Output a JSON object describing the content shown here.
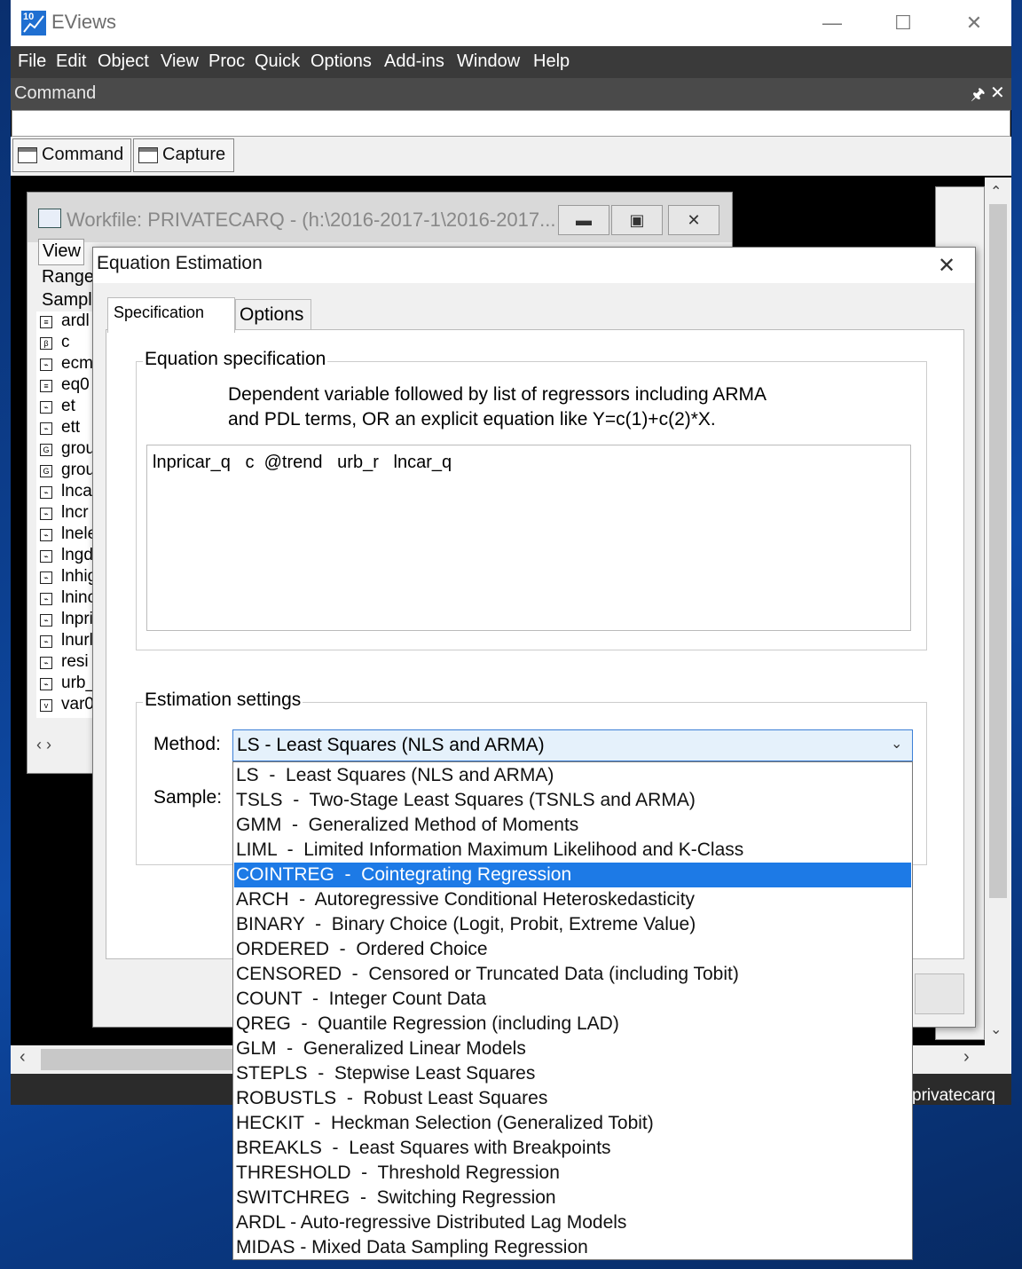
{
  "app": {
    "title": "EViews",
    "logo_text": "10",
    "minimize": "—",
    "maximize": "☐",
    "close": "✕"
  },
  "menu": [
    "File",
    "Edit",
    "Object",
    "View",
    "Proc",
    "Quick",
    "Options",
    "Add-ins",
    "Window",
    "Help"
  ],
  "command_pane": {
    "title": "Command",
    "pin": "🖈",
    "close": "✕",
    "tabs": [
      "Command",
      "Capture"
    ]
  },
  "workfile": {
    "title": "Workfile: PRIVATECARQ - (h:\\2016-2017-1\\2016-2017...",
    "view_btn": "View",
    "range_label": "Range",
    "sample_label": "Sampl",
    "objects": [
      {
        "icon": "eq",
        "name": "ardl"
      },
      {
        "icon": "β",
        "name": "c"
      },
      {
        "icon": "series",
        "name": "ecm"
      },
      {
        "icon": "eq",
        "name": "eq0"
      },
      {
        "icon": "series",
        "name": "et"
      },
      {
        "icon": "series",
        "name": "ett"
      },
      {
        "icon": "G",
        "name": "grou"
      },
      {
        "icon": "G",
        "name": "grou"
      },
      {
        "icon": "series",
        "name": "lnca"
      },
      {
        "icon": "series",
        "name": "lncr"
      },
      {
        "icon": "series",
        "name": "lnele"
      },
      {
        "icon": "series",
        "name": "lngd"
      },
      {
        "icon": "series",
        "name": "lnhig"
      },
      {
        "icon": "series",
        "name": "lninc"
      },
      {
        "icon": "series",
        "name": "lnpri"
      },
      {
        "icon": "series",
        "name": "lnurl"
      },
      {
        "icon": "series",
        "name": "resi"
      },
      {
        "icon": "series",
        "name": "urb_"
      },
      {
        "icon": "var",
        "name": "var0"
      }
    ],
    "scroll_glyphs": "‹ ›"
  },
  "status": {
    "workfile_name": "privatecarq"
  },
  "dialog": {
    "title": "Equation Estimation",
    "close": "✕",
    "tabs": {
      "specification": "Specification",
      "options": "Options"
    },
    "eq_spec_legend": "Equation specification",
    "help_line1": "Dependent variable followed by list of regressors including ARMA",
    "help_line2": "and PDL terms, OR an explicit equation like Y=c(1)+c(2)*X.",
    "equation": "lnpricar_q   c  @trend   urb_r   lncar_q",
    "est_legend": "Estimation settings",
    "method_label": "Method:",
    "sample_label": "Sample:",
    "method_selected": "LS  -  Least Squares (NLS and ARMA)",
    "method_options": [
      "LS  -  Least Squares (NLS and ARMA)",
      "TSLS  -  Two-Stage Least Squares (TSNLS and ARMA)",
      "GMM  -  Generalized Method of Moments",
      "LIML  -  Limited Information Maximum Likelihood and K-Class",
      "COINTREG  -  Cointegrating Regression",
      "ARCH  -  Autoregressive Conditional Heteroskedasticity",
      "BINARY  -  Binary Choice (Logit, Probit, Extreme Value)",
      "ORDERED  -  Ordered Choice",
      "CENSORED  -  Censored or Truncated Data (including Tobit)",
      "COUNT  -  Integer Count Data",
      "QREG  -  Quantile Regression (including LAD)",
      "GLM  -  Generalized Linear Models",
      "STEPLS  -  Stepwise Least Squares",
      "ROBUSTLS  -  Robust Least Squares",
      "HECKIT  -  Heckman Selection (Generalized Tobit)",
      "BREAKLS  -  Least Squares with Breakpoints",
      "THRESHOLD  -  Threshold Regression",
      "SWITCHREG  -  Switching Regression",
      "ARDL - Auto-regressive Distributed Lag Models",
      "MIDAS - Mixed Data Sampling Regression"
    ],
    "highlighted_option": "COINTREG  -  Cointegrating Regression"
  },
  "colors": {
    "highlight": "#1d7ae6",
    "menu_bar": "#3a3a3a",
    "desktop": "#0c3f8f"
  }
}
